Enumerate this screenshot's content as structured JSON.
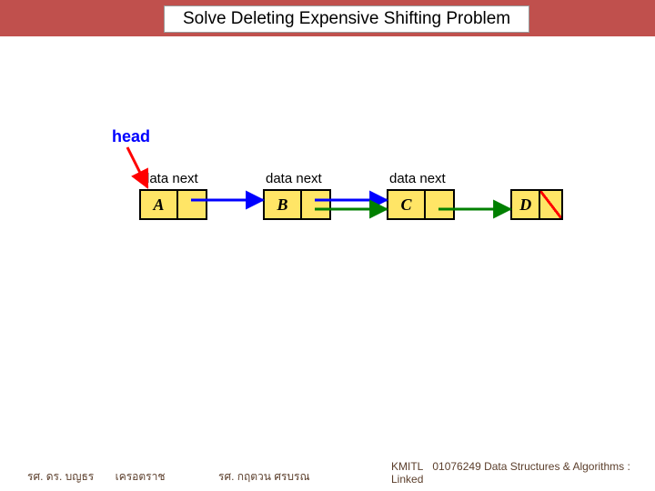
{
  "title": "Solve Deleting Expensive Shifting Problem",
  "diagram": {
    "head_label": "head",
    "field_labels": {
      "data": "data",
      "next": "next"
    },
    "nodes": [
      "A",
      "B",
      "C",
      "D"
    ]
  },
  "footer": {
    "author1": "รศ. ดร. บญธร",
    "author1b": "เครอตราช",
    "author2": "รศ. กฤตวน  ศรบรณ",
    "org": "KMITL",
    "course": "01076249 Data Structures & Algorithms : Linked"
  },
  "colors": {
    "accent": "#c0504d",
    "node_fill": "#ffe566",
    "head_text": "#0000ff",
    "arrow_red": "#ff0000",
    "arrow_blue": "#0000ff",
    "arrow_green": "#008000"
  }
}
